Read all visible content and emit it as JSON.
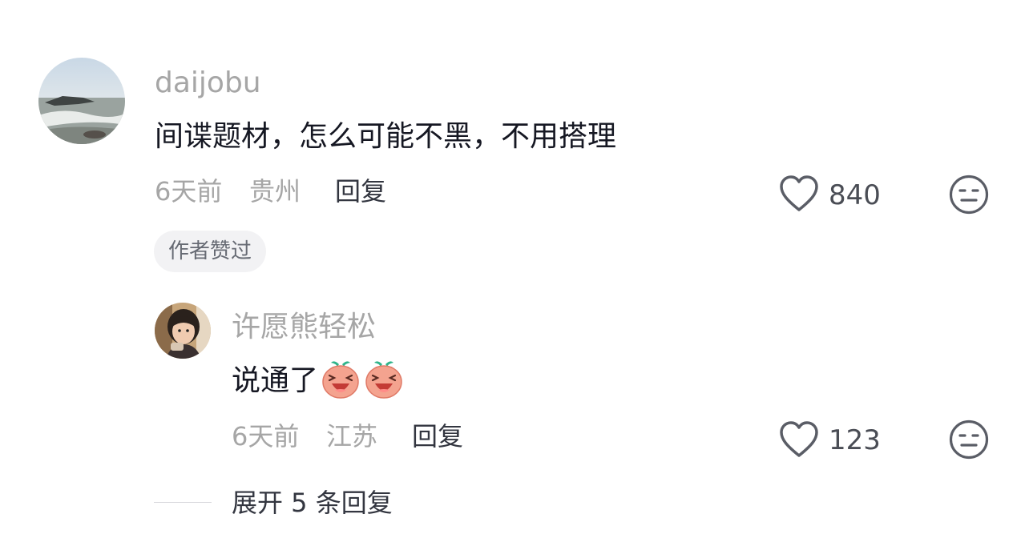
{
  "comment": {
    "username": "daijobu",
    "text": "间谍题材，怎么可能不黑，不用搭理",
    "time": "6天前",
    "location": "贵州",
    "reply_label": "回复",
    "like_count": "840",
    "badge": "作者赞过"
  },
  "reply": {
    "username": "许愿熊轻松",
    "text": "说通了",
    "emojis": [
      "laughing-peach-emoji",
      "laughing-peach-emoji"
    ],
    "time": "6天前",
    "location": "江苏",
    "reply_label": "回复",
    "like_count": "123"
  },
  "expand": {
    "label": "展开 5 条回复"
  }
}
